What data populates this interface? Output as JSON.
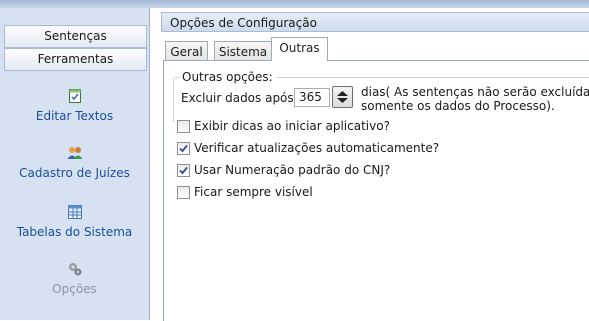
{
  "sidebar": {
    "section_sentencas": "Sentenças",
    "section_ferramentas": "Ferramentas",
    "items": [
      {
        "label": "Editar Textos",
        "icon": "document-edit-icon",
        "enabled": true
      },
      {
        "label": "Cadastro de Juízes",
        "icon": "users-icon",
        "enabled": true
      },
      {
        "label": "Tabelas do Sistema",
        "icon": "table-icon",
        "enabled": true
      },
      {
        "label": "Opções",
        "icon": "gears-icon",
        "enabled": false
      }
    ]
  },
  "panel": {
    "title": "Opções de Configuração",
    "tabs": [
      "Geral",
      "Sistema",
      "Outras"
    ],
    "active_tab": "Outras"
  },
  "outras": {
    "group_title": "Outras opções:",
    "excluir_label": "Excluir dados após",
    "excluir_value": "365",
    "excluir_unit_line1": "dias( As sentenças não serão excluídas,",
    "excluir_unit_line2": "somente os dados do Processo).",
    "checkboxes": [
      {
        "label": "Exibir dicas ao iniciar aplicativo?",
        "checked": false
      },
      {
        "label": "Verificar atualizações automaticamente?",
        "checked": true
      },
      {
        "label": "Usar Numeração padrão do CNJ?",
        "checked": true
      },
      {
        "label": "Ficar sempre visível",
        "checked": false
      }
    ]
  }
}
